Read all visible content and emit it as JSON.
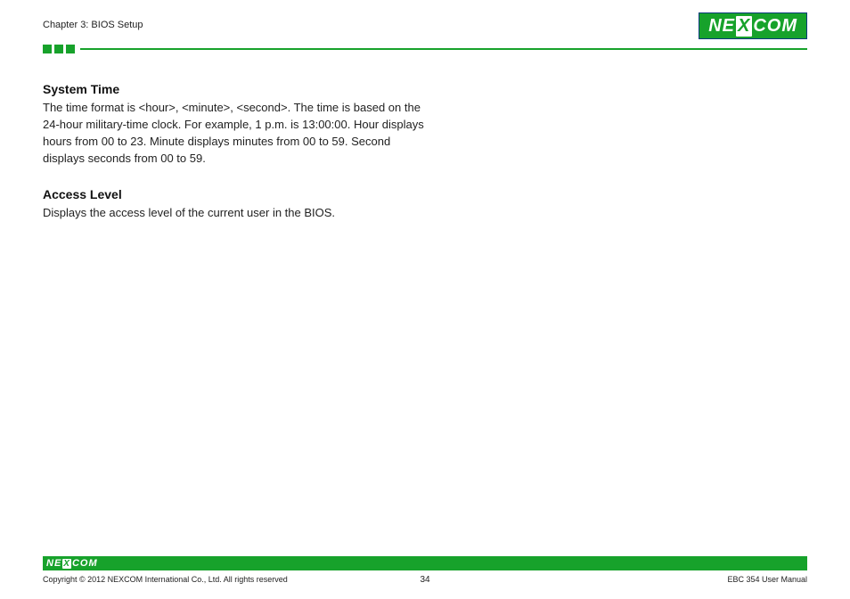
{
  "brand": {
    "name_left": "NE",
    "name_x": "X",
    "name_right": "COM"
  },
  "header": {
    "chapter": "Chapter 3: BIOS Setup"
  },
  "content": {
    "section1": {
      "title": "System Time",
      "body": "The time format is <hour>, <minute>, <second>. The time is based on the 24-hour military-time clock. For example, 1 p.m. is 13:00:00. Hour displays hours from 00 to 23. Minute displays minutes from 00 to 59. Second displays seconds from 00 to 59."
    },
    "section2": {
      "title": "Access Level",
      "body": "Displays the access level of the current user in the BIOS."
    }
  },
  "footer": {
    "copyright": "Copyright © 2012 NEXCOM International Co., Ltd. All rights reserved",
    "page_number": "34",
    "doc_title": "EBC 354 User Manual"
  }
}
